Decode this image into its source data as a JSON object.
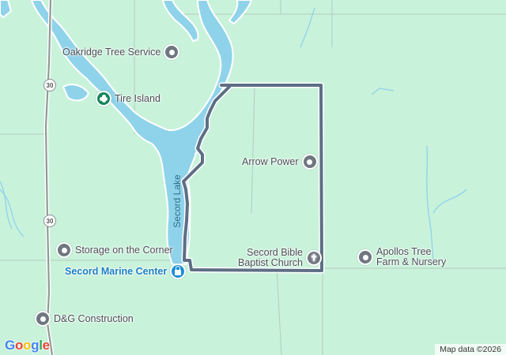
{
  "map": {
    "lake_name": "Secord Lake",
    "highway_number": "30",
    "attribution": "Map data ©2026",
    "logo_letters": [
      "G",
      "o",
      "o",
      "g",
      "l",
      "e"
    ],
    "logo_colors": [
      "#4285f4",
      "#ea4335",
      "#fbbc05",
      "#4285f4",
      "#34a853",
      "#ea4335"
    ]
  },
  "places": [
    {
      "name": "Oakridge Tree Service",
      "icon": "generic-pin-icon"
    },
    {
      "name": "Tire Island",
      "icon": "shop-flower-icon"
    },
    {
      "name": "Arrow Power",
      "icon": "generic-pin-icon"
    },
    {
      "name_line1": "Secord Bible",
      "name_line2": "Baptist Church",
      "icon": "church-cross-icon"
    },
    {
      "name_line1": "Apollos Tree",
      "name_line2": "Farm & Nursery",
      "icon": "generic-pin-icon"
    },
    {
      "name": "Storage on the Corner",
      "icon": "generic-pin-icon"
    },
    {
      "name": "Secord Marine Center",
      "icon": "shopping-bag-icon"
    },
    {
      "name": "D&G Construction",
      "icon": "generic-pin-icon"
    }
  ],
  "colors": {
    "land": "#c9f2db",
    "water": "#8fd3ea",
    "route": "#5d6e85",
    "road": "#a9bcae",
    "highway": "#8f9a95"
  }
}
